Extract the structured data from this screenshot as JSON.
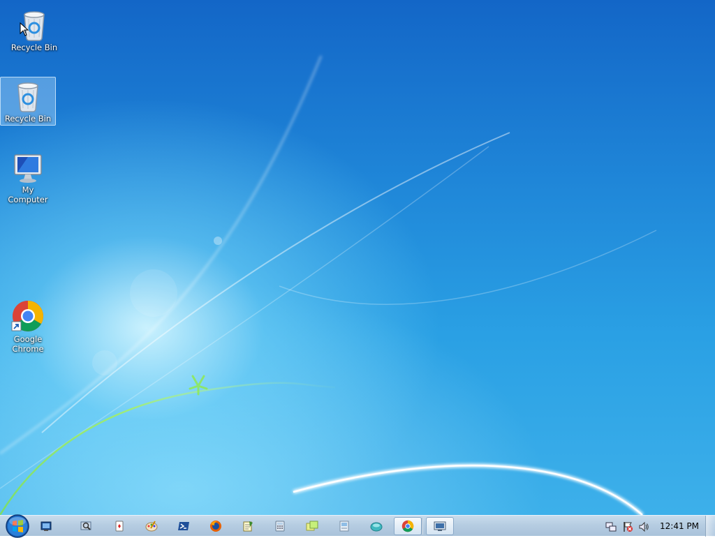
{
  "desktop": {
    "icons": [
      {
        "label": "Recycle Bin",
        "icon": "recycle-bin-icon"
      },
      {
        "label": "Recycle Bin",
        "icon": "recycle-bin-icon",
        "selected": true
      },
      {
        "label": "My Computer",
        "icon": "computer-icon"
      },
      {
        "label": "Google\nChrome",
        "icon": "chrome-shortcut-icon"
      }
    ]
  },
  "taskbar": {
    "start_icon": "windows-orb-icon",
    "pinned": [
      {
        "icon": "remote-desktop-icon"
      },
      {
        "icon": "magnifier-icon"
      },
      {
        "icon": "solitaire-icon"
      },
      {
        "icon": "paint-icon"
      },
      {
        "icon": "powershell-icon"
      },
      {
        "icon": "firefox-icon"
      },
      {
        "icon": "notepad-icon"
      },
      {
        "icon": "calculator-icon"
      },
      {
        "icon": "sticky-notes-icon"
      },
      {
        "icon": "file-transfer-icon"
      },
      {
        "icon": "teal-app-icon"
      },
      {
        "icon": "chrome-icon",
        "active": true
      },
      {
        "icon": "display-settings-icon",
        "active": true
      }
    ],
    "tray": {
      "icons": [
        "network-icon",
        "action-center-flag-icon",
        "volume-icon"
      ],
      "clock": "12:41 PM"
    }
  },
  "colors": {
    "desktop_top": "#1366c7",
    "desktop_bottom": "#3db0ea",
    "taskbar": "#b6cde2"
  }
}
